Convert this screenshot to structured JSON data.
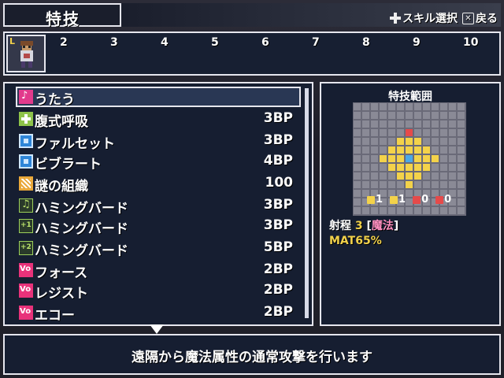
{
  "header": {
    "title": "特技",
    "hint_select": "スキル選択",
    "hint_back": "戻る"
  },
  "party": {
    "selected_badge": "L",
    "slots": [
      "2",
      "3",
      "4",
      "5",
      "6",
      "7",
      "8",
      "9",
      "10"
    ]
  },
  "skills": [
    {
      "name": "うたう",
      "cost": "",
      "icon": "sing-icon"
    },
    {
      "name": "腹式呼吸",
      "cost": "3BP",
      "icon": "plus-icon"
    },
    {
      "name": "ファルセット",
      "cost": "3BP",
      "icon": "blue-square-icon"
    },
    {
      "name": "ビブラート",
      "cost": "4BP",
      "icon": "blue-square-icon"
    },
    {
      "name": "謎の組織",
      "cost": "100",
      "icon": "riddle-icon"
    },
    {
      "name": "ハミングバード",
      "cost": "3BP",
      "icon": "note-icon"
    },
    {
      "name": "ハミングバード",
      "cost": "3BP",
      "icon": "note-plus1-icon"
    },
    {
      "name": "ハミングバード",
      "cost": "5BP",
      "icon": "note-plus2-icon"
    },
    {
      "name": "フォース",
      "cost": "2BP",
      "icon": "vo-icon"
    },
    {
      "name": "レジスト",
      "cost": "2BP",
      "icon": "vo-icon"
    },
    {
      "name": "エコー",
      "cost": "2BP",
      "icon": "vo-icon"
    }
  ],
  "range_panel": {
    "title": "特技範囲",
    "arrow_values": [
      "1",
      "1",
      "0",
      "0"
    ],
    "range_label": "射程",
    "range_value": "3",
    "range_type_open": "[",
    "range_type": "魔法",
    "range_type_close": "]",
    "stat": "MAT65%"
  },
  "description": "遠隔から魔法属性の通常攻撃を行います",
  "colors": {
    "accent_yellow": "#f3d24a",
    "accent_pink": "#ff8fc0",
    "panel_bg": "#161e32"
  }
}
